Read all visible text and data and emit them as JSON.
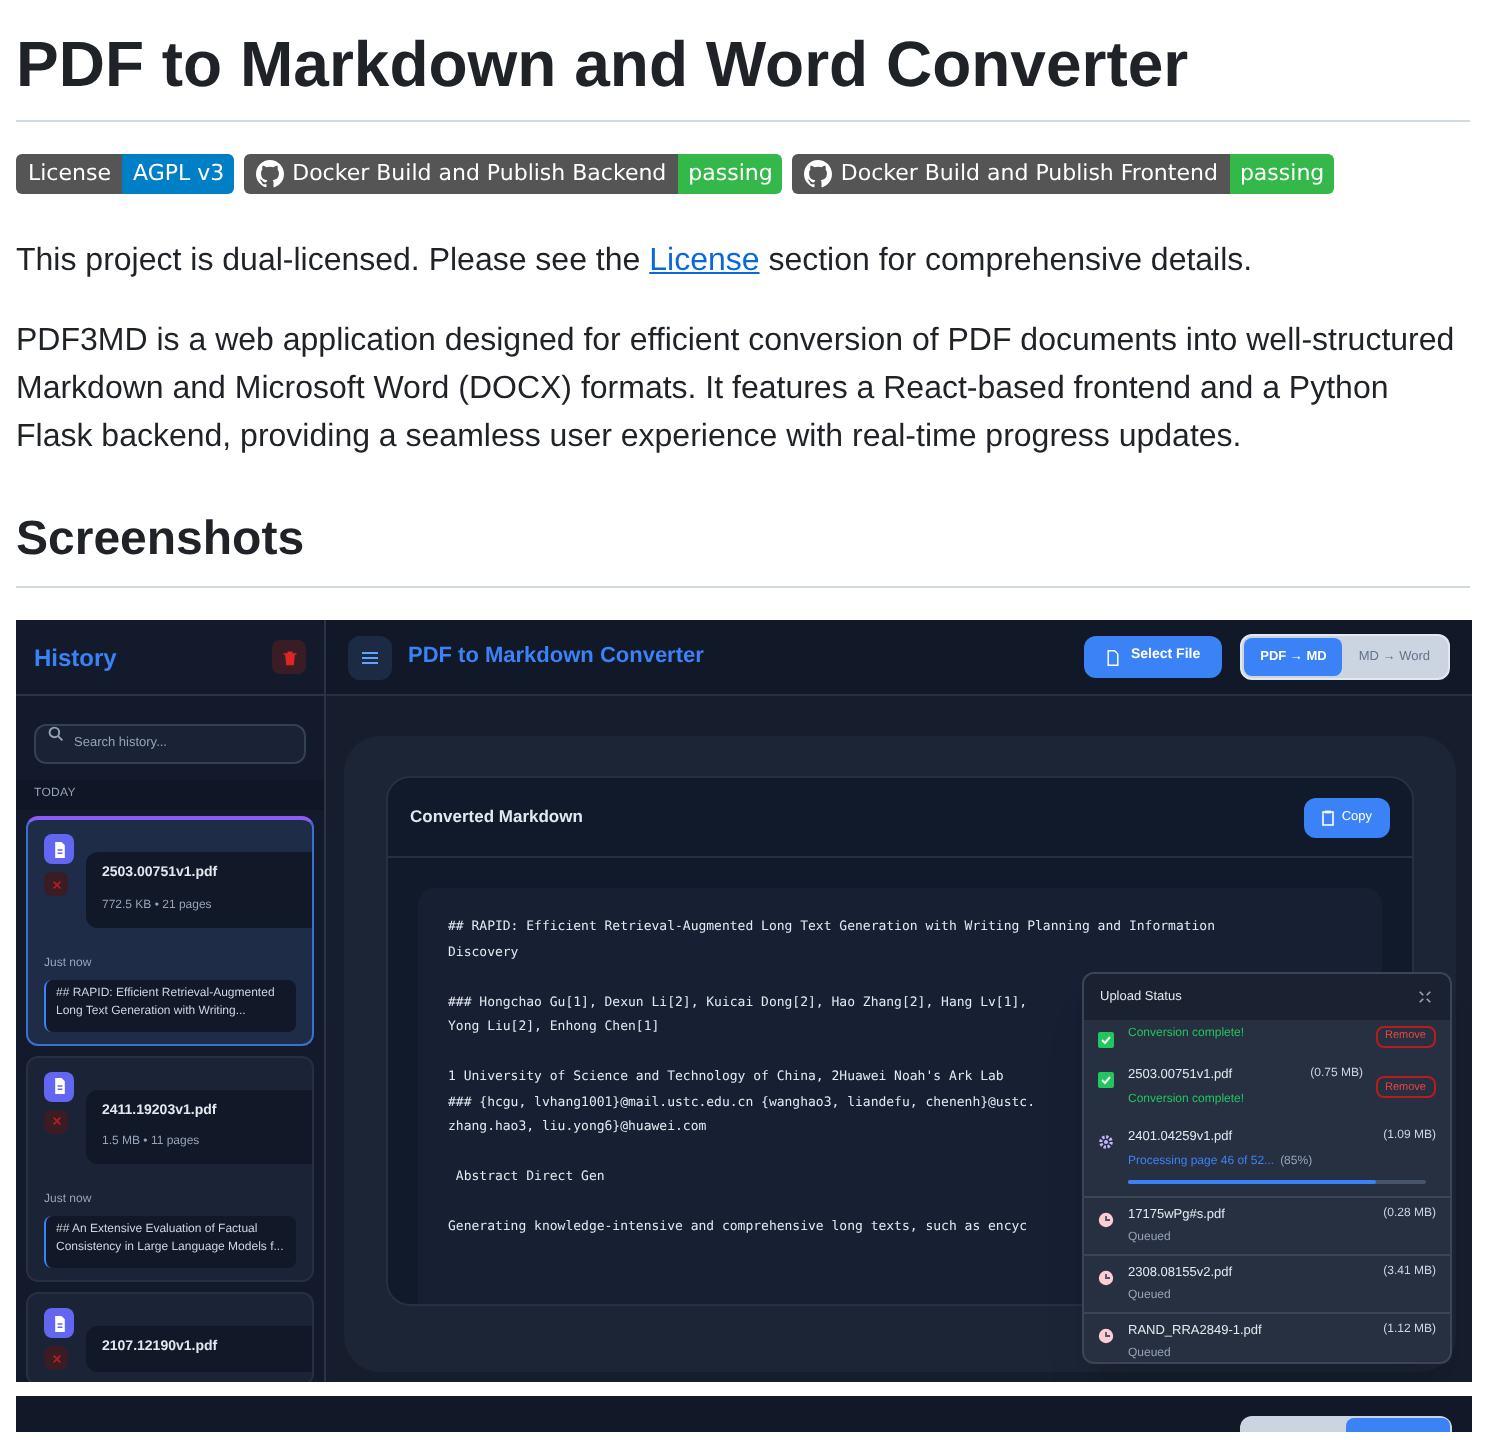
{
  "title": "PDF to Markdown and Word Converter",
  "badges": [
    {
      "kind": "plain",
      "label": "License",
      "message": "AGPL v3",
      "color": "#007ec6"
    },
    {
      "kind": "github",
      "label": "Docker Build and Publish Backend",
      "message": "passing",
      "color": "#34b84a"
    },
    {
      "kind": "github",
      "label": "Docker Build and Publish Frontend",
      "message": "passing",
      "color": "#34b84a"
    }
  ],
  "intro": {
    "before": "This project is dual-licensed. Please see the ",
    "link": "License",
    "after": " section for comprehensive details."
  },
  "description": "PDF3MD is a web application designed for efficient conversion of PDF documents into well-structured Markdown and Microsoft Word (DOCX) formats. It features a React-based frontend and a Python Flask backend, providing a seamless user experience with real-time progress updates.",
  "section_heading": "Screenshots",
  "screenshot": {
    "sidebar": {
      "title": "History",
      "search_placeholder": "Search history...",
      "group": "TODAY",
      "items": [
        {
          "name": "2503.00751v1.pdf",
          "meta": "772.5 KB • 21 pages",
          "time": "Just now",
          "preview": "## RAPID: Efficient Retrieval-Augmented Long Text Generation with Writing...",
          "selected": true
        },
        {
          "name": "2411.19203v1.pdf",
          "meta": "1.5 MB • 11 pages",
          "time": "Just now",
          "preview": "## An Extensive Evaluation of Factual Consistency in Large Language Models f...",
          "selected": false
        },
        {
          "name": "2107.12190v1.pdf",
          "selected": false
        }
      ]
    },
    "header": {
      "title": "PDF to Markdown Converter",
      "select_button": "Select File",
      "modes": [
        {
          "label": "PDF → MD",
          "selected": true
        },
        {
          "label": "MD → Word",
          "selected": false
        }
      ]
    },
    "output": {
      "title": "Converted Markdown",
      "copy_button": "Copy",
      "paragraphs": [
        [
          "## RAPID: Efficient Retrieval-Augmented Long Text Generation with Writing Planning and Information",
          "Discovery"
        ],
        [
          "### Hongchao Gu[1], Dexun Li[2], Kuicai Dong[2], Hao Zhang[2], Hang Lv[1],",
          "Yong Liu[2], Enhong Chen[1]"
        ],
        [
          "1 University of Science and Technology of China, 2Huawei Noah's Ark Lab",
          "### {hcgu, lvhang1001}@mail.ustc.edu.cn {wanghao3, liandefu, chenenh}@ustc.",
          "zhang.hao3, liu.yong6}@huawei.com"
        ],
        [
          " Abstract Direct Gen"
        ],
        [
          "Generating knowledge-intensive and comprehensive long texts, such as encyc"
        ]
      ]
    },
    "upload_status": {
      "title": "Upload Status",
      "items": [
        {
          "kind": "complete",
          "status": "Conversion complete!",
          "remove": "Remove"
        },
        {
          "kind": "complete",
          "name": "2503.00751v1.pdf",
          "size": "(0.75 MB)",
          "status": "Conversion complete!",
          "remove": "Remove"
        },
        {
          "kind": "processing",
          "name": "2401.04259v1.pdf",
          "size": "(1.09 MB)",
          "status": "Processing page 46 of 52...",
          "percent": "(85%)",
          "level": 0.83
        },
        {
          "kind": "queued",
          "name": "17175wPg#s.pdf",
          "size": "(0.28 MB)",
          "status": "Queued"
        },
        {
          "kind": "queued",
          "name": "2308.08155v2.pdf",
          "size": "(3.41 MB)",
          "status": "Queued"
        },
        {
          "kind": "queued",
          "name": "RAND_RRA2849-1.pdf",
          "size": "(1.12 MB)",
          "status": "Queued"
        }
      ]
    }
  }
}
